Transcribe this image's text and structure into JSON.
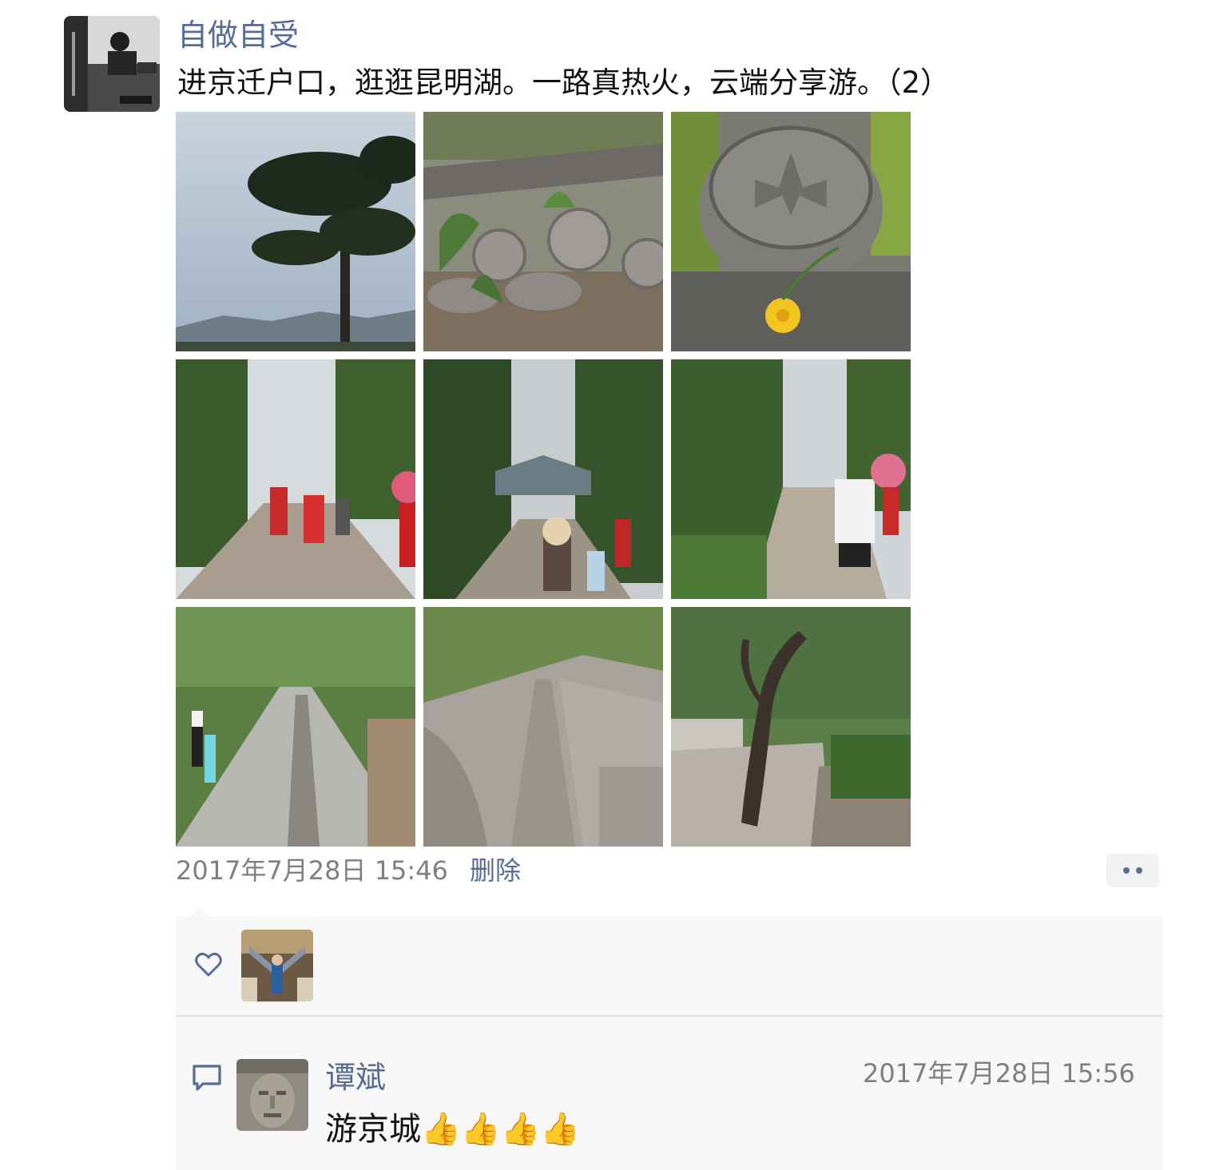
{
  "post": {
    "author": "自做自受",
    "avatar_icon": "avatar-image",
    "text": "进京迁户口，逛逛昆明湖。一路真热火，云端分享游。（2）",
    "time": "2017年7月28日 15:46",
    "delete_label": "删除",
    "more_icon": "more-dots-icon",
    "photos": [
      {
        "name": "photo-pine-tree-sky"
      },
      {
        "name": "photo-roof-tiles-plants"
      },
      {
        "name": "photo-tile-flower"
      },
      {
        "name": "photo-path-crowd"
      },
      {
        "name": "photo-path-trees-valley"
      },
      {
        "name": "photo-path-walkers"
      },
      {
        "name": "photo-tree-lined-path"
      },
      {
        "name": "photo-stone-path"
      },
      {
        "name": "photo-twisted-tree"
      }
    ]
  },
  "likes": {
    "icon": "heart-icon",
    "users": [
      {
        "avatar": "liker-avatar"
      }
    ]
  },
  "comments": [
    {
      "icon": "comment-icon",
      "author": "谭斌",
      "time": "2017年7月28日 15:56",
      "text": "游京城👍👍👍👍"
    }
  ],
  "colors": {
    "link": "#576b95",
    "text": "#111111",
    "meta": "#7f7f7f",
    "panel": "#f7f7f7"
  }
}
